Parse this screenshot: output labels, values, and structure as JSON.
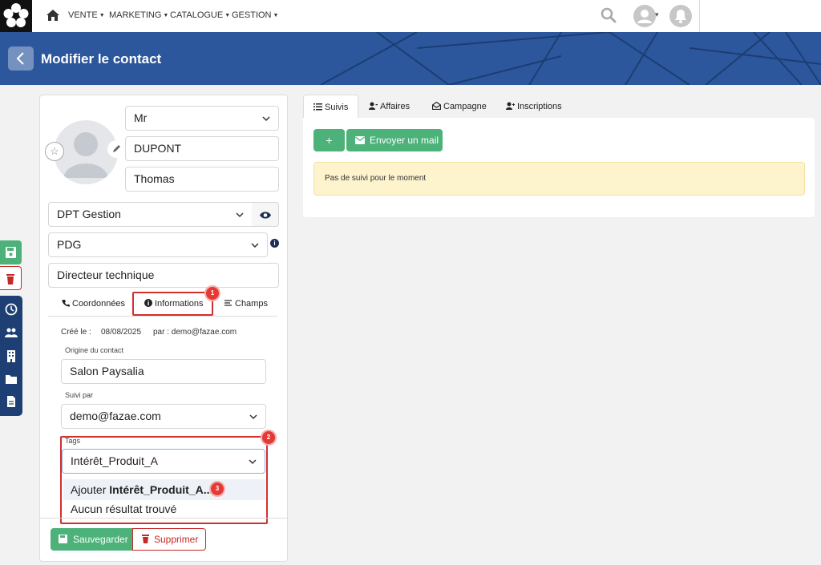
{
  "nav": {
    "items": [
      {
        "label": "VENTE"
      },
      {
        "label": "MARKETING"
      },
      {
        "label": "CATALOGUE"
      },
      {
        "label": "GESTION"
      }
    ]
  },
  "header": {
    "title": "Modifier le contact",
    "color": "#2c579d"
  },
  "contact": {
    "civility": "Mr",
    "last_name": "DUPONT",
    "first_name": "Thomas",
    "company": "DPT Gestion",
    "role": "PDG",
    "job_title": "Directeur technique"
  },
  "subtabs": {
    "coordonnees": "Coordonnées",
    "informations": "Informations",
    "champs": "Champs"
  },
  "info": {
    "created_label": "Créé le :",
    "created_date": "08/08/2025",
    "by_label": "par : demo@fazae.com",
    "origin_label": "Origine du contact",
    "origin_value": "Salon Paysalia",
    "followed_label": "Suivi par",
    "followed_value": "demo@fazae.com",
    "tags_label": "Tags",
    "tags_input": "Intérêt_Produit_A",
    "dropdown": {
      "add_prefix": "Ajouter ",
      "add_value": "Intérêt_Produit_A...",
      "no_result": "Aucun résultat trouvé"
    }
  },
  "annotations": [
    "1",
    "2",
    "3"
  ],
  "actions": {
    "save": "Sauvegarder",
    "delete": "Supprimer"
  },
  "right_tabs": [
    {
      "label": "Suivis"
    },
    {
      "label": "Affaires"
    },
    {
      "label": "Campagne"
    },
    {
      "label": "Inscriptions"
    }
  ],
  "suivi": {
    "add_label": "+",
    "mail_label": "Envoyer un mail",
    "empty_message": "Pas de suivi pour le moment"
  },
  "colors": {
    "accent_green": "#4cb27a",
    "danger_red": "#c62828",
    "navy": "#1d3f73",
    "alert_bg": "#fdf3cc"
  }
}
